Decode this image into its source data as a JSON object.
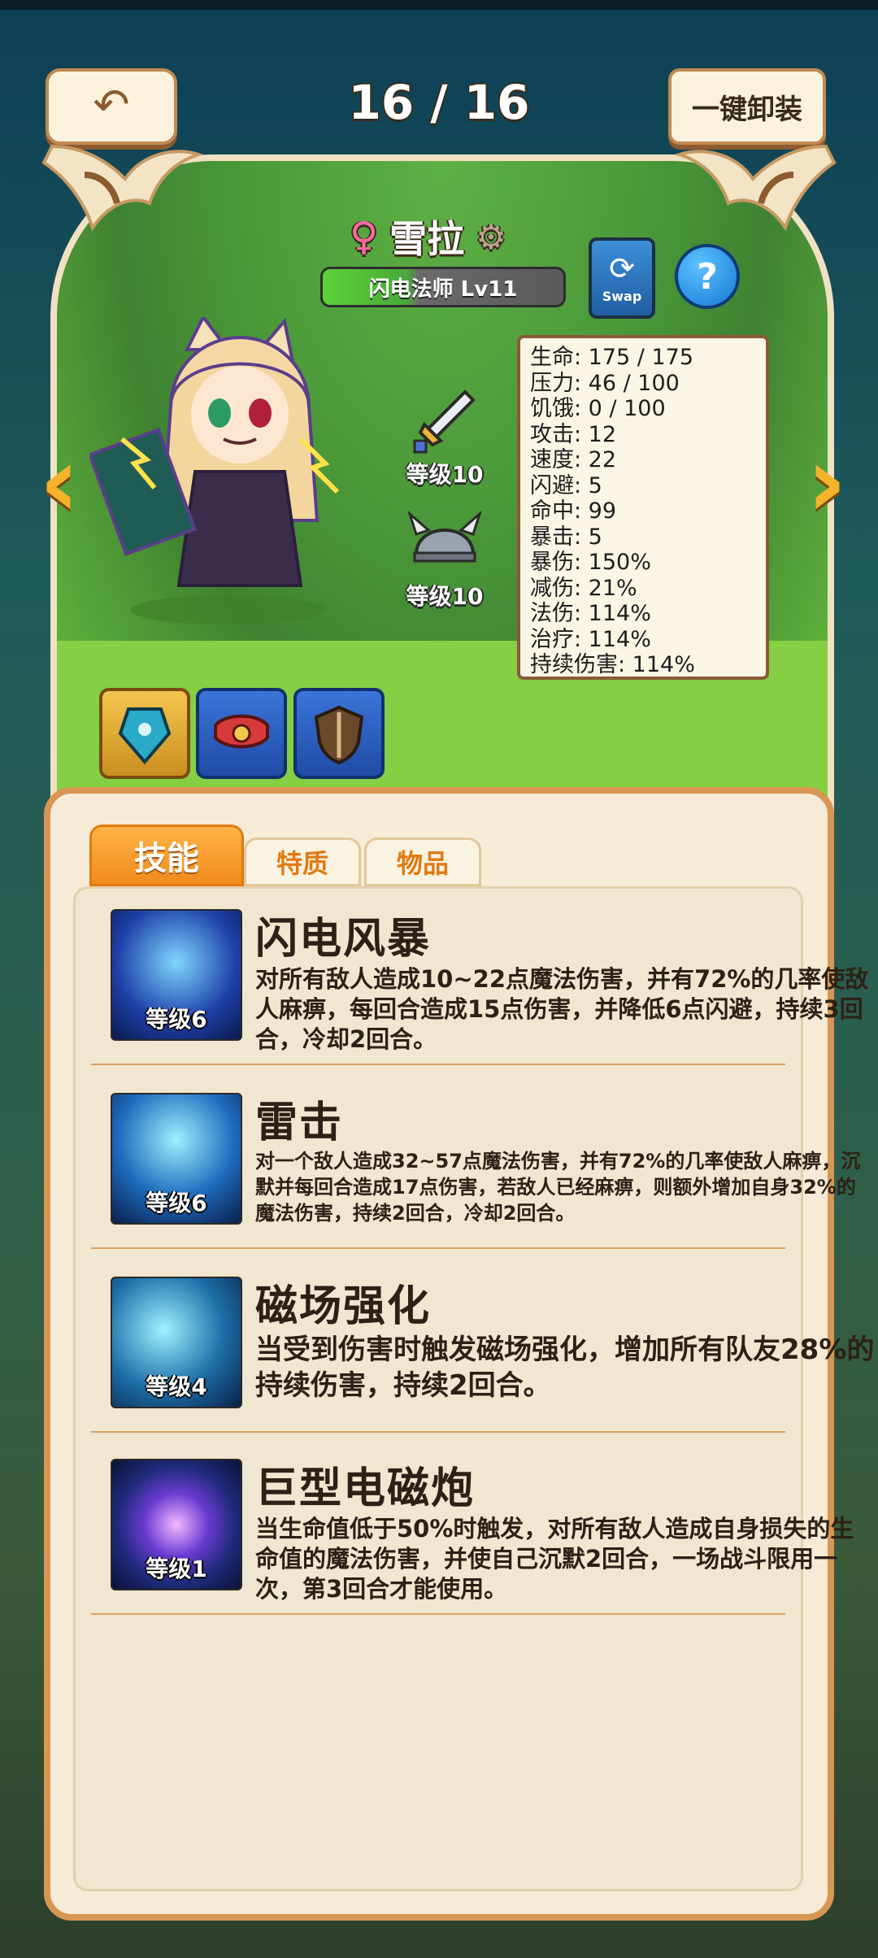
{
  "header": {
    "counter": "16 / 16",
    "unequip_label": "一键卸装"
  },
  "character": {
    "name": "雪拉",
    "class_level": "闪电法师 Lv11",
    "swap_label": "Swap",
    "help": "?"
  },
  "equipment": {
    "weapon_level": "等级10",
    "helmet_level": "等级10"
  },
  "stats": [
    "生命: 175 / 175",
    "压力: 46 / 100",
    "饥饿: 0 / 100",
    "攻击: 12",
    "速度: 22",
    "闪避: 5",
    "命中: 99",
    "暴击: 5",
    "暴伤: 150%",
    "减伤: 21%",
    "法伤: 114%",
    "治疗: 114%",
    "持续伤害: 114%"
  ],
  "tabs": {
    "skills": "技能",
    "traits": "特质",
    "items": "物品"
  },
  "skills": [
    {
      "name": "闪电风暴",
      "level": "等级6",
      "desc": "对所有敌人造成10~22点魔法伤害，并有72%的几率使敌人麻痹，每回合造成15点伤害，并降低6点闪避，持续3回合，冷却2回合。"
    },
    {
      "name": "雷击",
      "level": "等级6",
      "desc": "对一个敌人造成32~57点魔法伤害，并有72%的几率使敌人麻痹，沉默并每回合造成17点伤害，若敌人已经麻痹，则额外增加自身32%的魔法伤害，持续2回合，冷却2回合。"
    },
    {
      "name": "磁场强化",
      "level": "等级4",
      "desc": "当受到伤害时触发磁场强化，增加所有队友28%的持续伤害，持续2回合。"
    },
    {
      "name": "巨型电磁炮",
      "level": "等级1",
      "desc": "当生命值低于50%时触发，对所有敌人造成自身损失的生命值的魔法伤害，并使自己沉默2回合，一场战斗限用一次，第3回合才能使用。"
    }
  ],
  "colors": {
    "accent_orange": "#f28a1c",
    "panel_border": "#d99653",
    "level_bar_green": "#5bd338"
  }
}
